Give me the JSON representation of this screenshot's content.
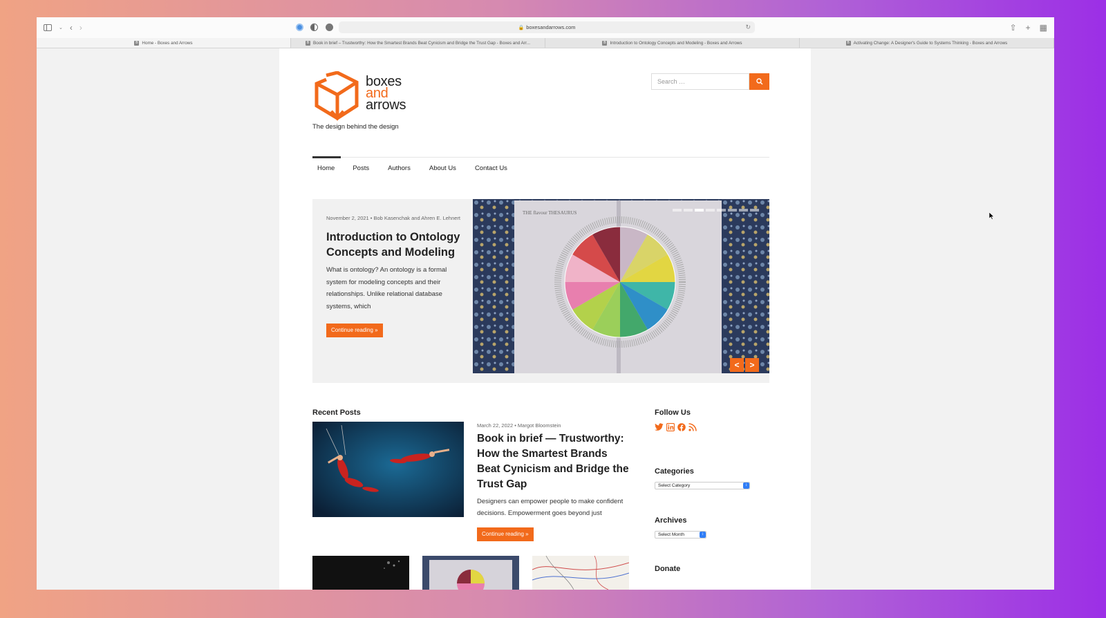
{
  "browser": {
    "url": "boxesandarrows.com",
    "tabs": [
      {
        "label": "Home - Boxes and Arrows",
        "active": true
      },
      {
        "label": "Book in brief – Trustworthy: How the Smartest Brands Beat Cynicism and Bridge the Trust Gap - Boxes and Arr...",
        "active": false
      },
      {
        "label": "Introduction to Ontology Concepts and Modeling - Boxes and Arrows",
        "active": false
      },
      {
        "label": "Activating Change: A Designer's Guide to Systems Thinking - Boxes and Arrows",
        "active": false
      }
    ]
  },
  "site": {
    "brand_line1": "boxes",
    "brand_line2": "and",
    "brand_line3": "arrows",
    "tagline": "The design behind the design",
    "accent_color": "#f26a1b"
  },
  "search": {
    "placeholder": "Search …"
  },
  "nav": {
    "items": [
      {
        "label": "Home"
      },
      {
        "label": "Posts"
      },
      {
        "label": "Authors"
      },
      {
        "label": "About Us"
      },
      {
        "label": "Contact Us"
      }
    ]
  },
  "hero": {
    "meta": "November 2, 2021  •  Bob Kasenchak and Ahren E. Lehnert",
    "title": "Introduction to Ontology Concepts and Modeling",
    "excerpt": "What is ontology? An ontology is a formal system for modeling concepts and their relationships. Unlike relational database systems, which",
    "button": "Continue reading »",
    "image_caption": "THE flavour THESAURUS",
    "prev": "<",
    "next": ">"
  },
  "recent": {
    "heading": "Recent Posts",
    "post": {
      "meta": "March 22, 2022  •  Margot Bloomstein",
      "title": "Book in brief — Trustworthy: How the Smartest Brands Beat Cynicism and Bridge the Trust Gap",
      "excerpt": "Designers can empower people to make confident decisions. Empowerment goes beyond just",
      "button": "Continue reading »"
    }
  },
  "sidebar": {
    "follow_heading": "Follow Us",
    "social_icons": [
      "twitter-icon",
      "linkedin-icon",
      "facebook-icon",
      "rss-icon"
    ],
    "categories_heading": "Categories",
    "categories_selected": "Select Category",
    "archives_heading": "Archives",
    "archives_selected": "Select Month",
    "donate_heading": "Donate"
  }
}
